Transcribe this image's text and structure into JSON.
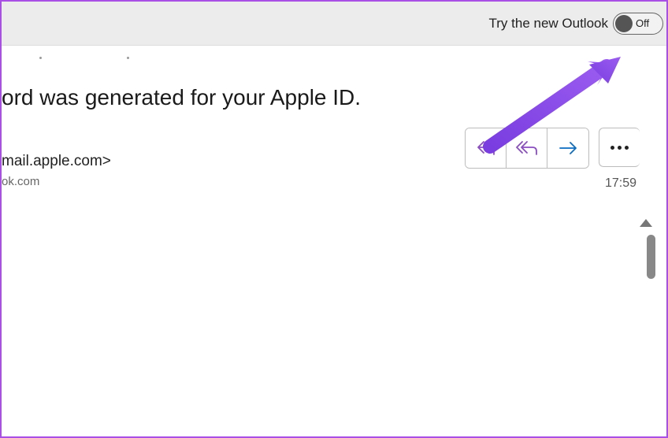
{
  "header": {
    "toggle_label": "Try the new Outlook",
    "toggle_state": "Off"
  },
  "message": {
    "subject": "ord was generated for your Apple ID.",
    "from": "mail.apple.com>",
    "to": "ok.com",
    "time": "17:59"
  }
}
